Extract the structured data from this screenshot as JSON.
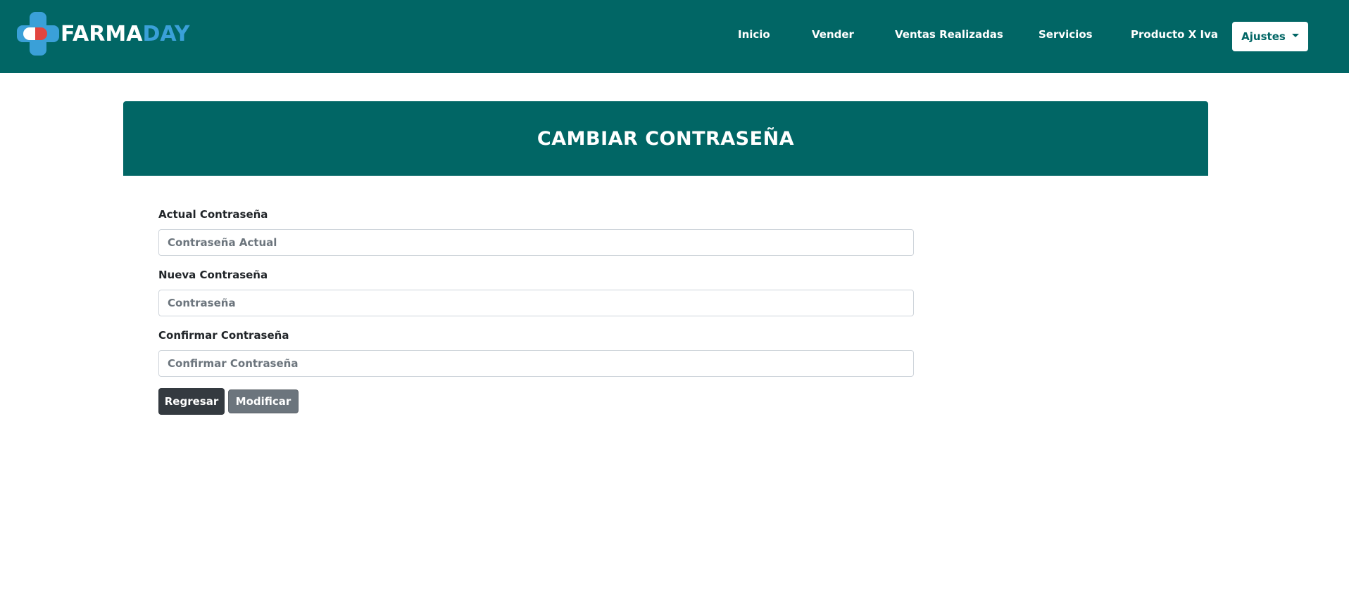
{
  "navbar": {
    "brand_part1": "FARMA",
    "brand_part2": "DAY",
    "links": [
      "Inicio",
      "Vender",
      "Ventas Realizadas",
      "Servicios",
      "Producto X Iva"
    ],
    "settings_label": "Ajustes"
  },
  "page": {
    "title": "CAMBIAR CONTRASEÑA"
  },
  "form": {
    "current_password": {
      "label": "Actual Contraseña",
      "placeholder": "Contraseña Actual",
      "value": ""
    },
    "new_password": {
      "label": "Nueva Contraseña",
      "placeholder": "Contraseña",
      "value": ""
    },
    "confirm_password": {
      "label": "Confirmar Contraseña",
      "placeholder": "Confirmar Contraseña",
      "value": ""
    },
    "back_button": "Regresar",
    "submit_button": "Modificar"
  },
  "colors": {
    "primary": "#016665",
    "brand_blue": "#3aa0d8",
    "brand_red": "#e2453f",
    "dark_button": "#343a40",
    "secondary_button": "#6c757d"
  },
  "icons": {
    "logo": "medical-cross-pill-icon",
    "dropdown": "caret-down-icon"
  }
}
